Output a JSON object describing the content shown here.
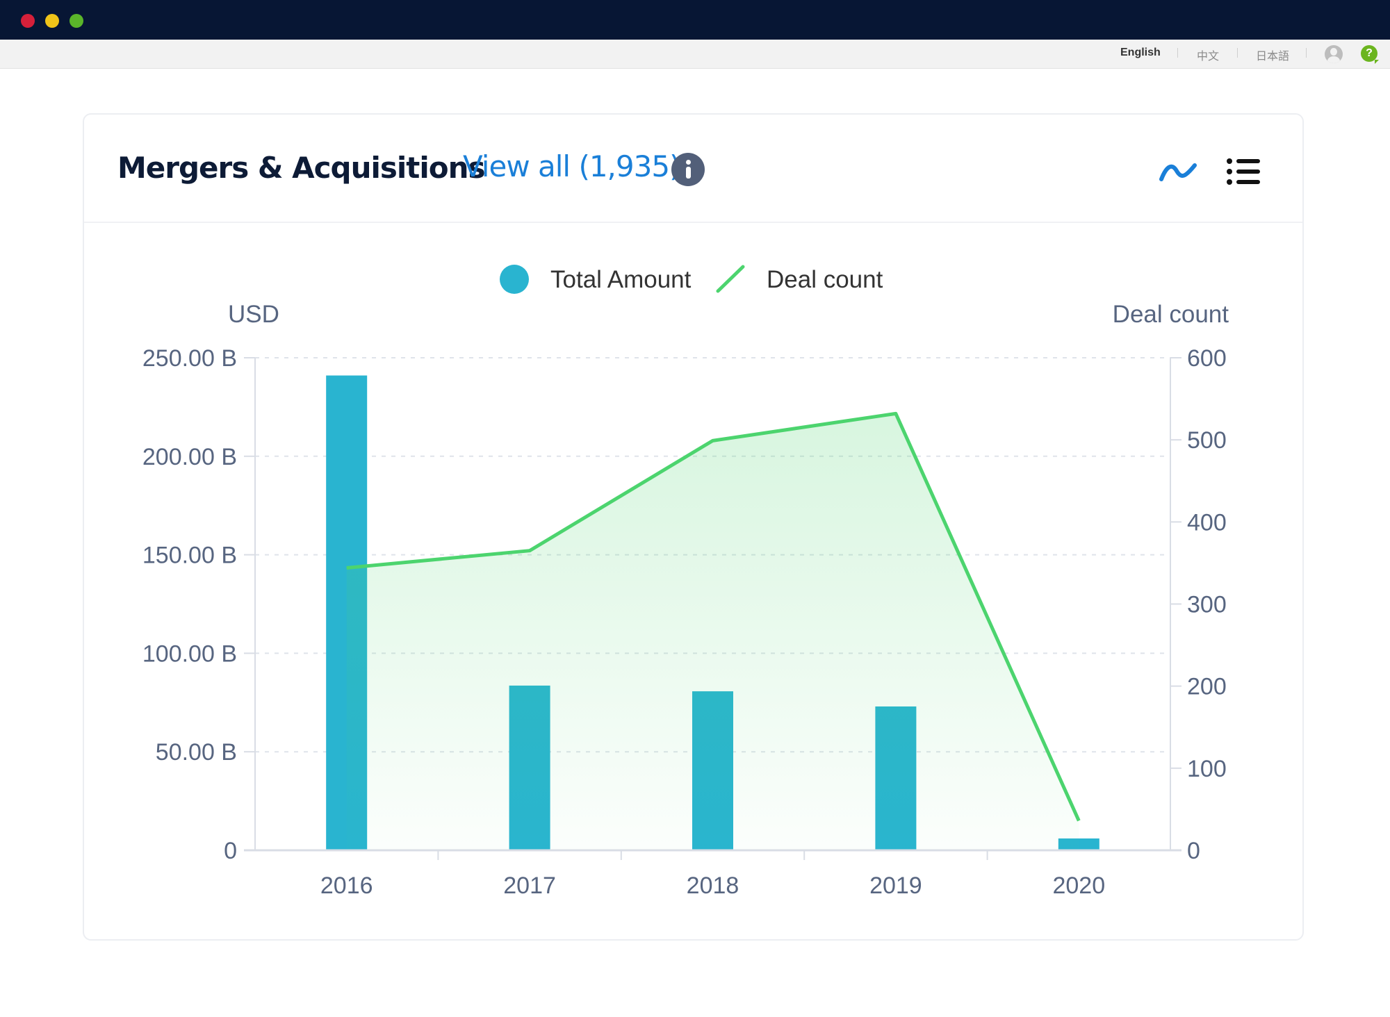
{
  "window": {
    "controls": [
      "close",
      "minimize",
      "maximize"
    ]
  },
  "topnav": {
    "languages": [
      {
        "label": "English",
        "active": true
      },
      {
        "label": "中文",
        "active": false
      },
      {
        "label": "日本語",
        "active": false
      }
    ],
    "user_icon": "user-avatar-icon",
    "help_icon": "help-icon",
    "help_label": "?"
  },
  "card": {
    "title": "Mergers & Acquisitions",
    "view_all_label": "View all (1,935)",
    "info_icon": "info-icon",
    "chart_view_icon": "line-chart-icon",
    "list_view_icon": "list-icon"
  },
  "colors": {
    "bar": "#29b4d0",
    "line": "#4cd46e",
    "area_top": "#d7f3dd",
    "grid": "#dfe3ea",
    "axis": "#d9dde5",
    "axis_text": "#576580",
    "brand_link": "#1a7fd8",
    "title": "#0d1b36"
  },
  "chart_data": {
    "type": "bar",
    "title": "",
    "categories": [
      "2016",
      "2017",
      "2018",
      "2019",
      "2020"
    ],
    "series": [
      {
        "name": "Total Amount",
        "type": "bar",
        "axis": "left",
        "unit": "B USD",
        "values": [
          241,
          83.6,
          80.7,
          73,
          6
        ]
      },
      {
        "name": "Deal count",
        "type": "area",
        "axis": "right",
        "values": [
          344,
          365,
          499,
          532,
          36
        ]
      }
    ],
    "legend": {
      "position": "top-center",
      "entries": [
        {
          "label": "Total Amount",
          "symbol": "circle"
        },
        {
          "label": "Deal count",
          "symbol": "line"
        }
      ]
    },
    "y_left": {
      "label": "USD",
      "range": [
        0,
        250
      ],
      "ticks": [
        0,
        50,
        100,
        150,
        200,
        250
      ],
      "tick_labels": [
        "0",
        "50.00 B",
        "100.00 B",
        "150.00 B",
        "200.00 B",
        "250.00 B"
      ]
    },
    "y_right": {
      "label": "Deal count",
      "range": [
        0,
        600
      ],
      "ticks": [
        0,
        100,
        200,
        300,
        400,
        500,
        600
      ],
      "tick_labels": [
        "0",
        "100",
        "200",
        "300",
        "400",
        "500",
        "600"
      ]
    },
    "xlabel": "",
    "grid": true
  }
}
